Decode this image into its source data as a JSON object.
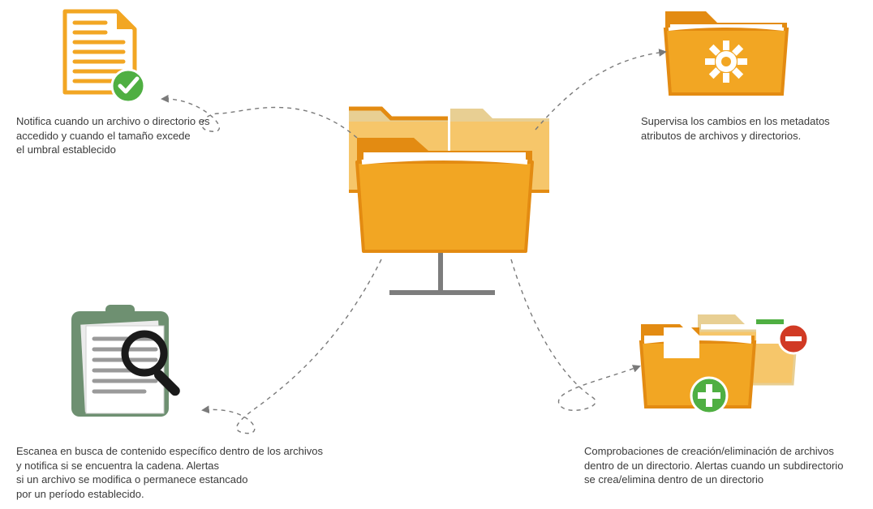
{
  "top_left": {
    "text_l1": "Notifica cuando un archivo o directorio es",
    "text_l2": "accedido y cuando el tamaño excede",
    "text_l3": "el umbral establecido"
  },
  "top_right": {
    "text_l1": "Supervisa los cambios en los metadatos",
    "text_l2": "atributos de archivos y directorios."
  },
  "bottom_left": {
    "text_l1": "Escanea en busca de contenido específico dentro de los archivos",
    "text_l2": "y notifica si se encuentra la cadena. Alertas",
    "text_l3": "si un archivo se modifica o permanece estancado",
    "text_l4": "por un período establecido."
  },
  "bottom_right": {
    "text_l1": "Comprobaciones de creación/eliminación de archivos",
    "text_l2": "dentro de un directorio. Alertas cuando un subdirectorio",
    "text_l3": "se crea/elimina dentro de un directorio"
  },
  "colors": {
    "orange_dark": "#E38B12",
    "orange_mid": "#F2A623",
    "orange_lt": "#F6C66A",
    "tan": "#E8CF93",
    "green": "#4FAF42",
    "green_dk": "#6E9071",
    "red": "#D13A24",
    "dash": "#7a7a7a"
  }
}
